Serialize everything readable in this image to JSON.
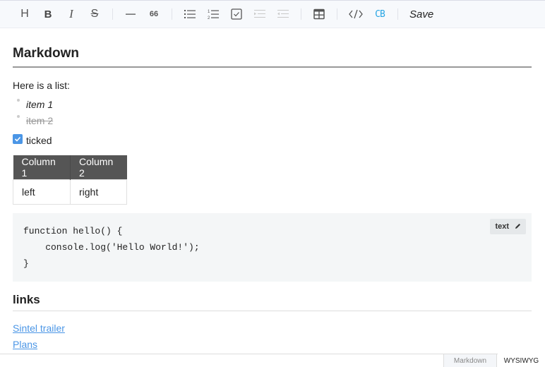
{
  "toolbar": {
    "buttons": [
      {
        "name": "heading",
        "icon": "heading-icon",
        "glyph": "H"
      },
      {
        "name": "bold",
        "icon": "bold-icon",
        "glyph": "B"
      },
      {
        "name": "italic",
        "icon": "italic-icon",
        "glyph": "I"
      },
      {
        "name": "strike",
        "icon": "strikethrough-icon",
        "glyph": "S"
      },
      {
        "name": "hr",
        "icon": "horizontal-rule-icon"
      },
      {
        "name": "quote",
        "icon": "quote-icon",
        "glyph": "66"
      },
      {
        "name": "ul",
        "icon": "bullet-list-icon"
      },
      {
        "name": "ol",
        "icon": "numbered-list-icon"
      },
      {
        "name": "task",
        "icon": "task-list-icon"
      },
      {
        "name": "indent",
        "icon": "indent-icon"
      },
      {
        "name": "outdent",
        "icon": "outdent-icon"
      },
      {
        "name": "table",
        "icon": "table-icon"
      },
      {
        "name": "code",
        "icon": "code-icon",
        "glyph": "</>"
      },
      {
        "name": "codeblock",
        "icon": "codeblock-icon",
        "glyph": "CB"
      }
    ],
    "save_label": "Save",
    "accent_color": "#28a6e4"
  },
  "document": {
    "heading1": "Markdown",
    "intro": "Here is a list:",
    "list": [
      {
        "text": "item 1",
        "style": "italic"
      },
      {
        "text": "item 2",
        "style": "strikethrough"
      }
    ],
    "task": {
      "label": "ticked",
      "checked": true
    },
    "table": {
      "headers": [
        "Column 1",
        "Column 2"
      ],
      "rows": [
        [
          "left",
          "right"
        ]
      ]
    },
    "code": {
      "language": "text",
      "lines": [
        "function hello() {",
        "    console.log('Hello World!');",
        "}"
      ]
    },
    "heading2": "links",
    "links": [
      {
        "text": "Sintel trailer"
      },
      {
        "text": "Plans"
      }
    ],
    "link_color": "#4b96e6"
  },
  "mode_switch": {
    "tabs": [
      "Markdown",
      "WYSIWYG"
    ],
    "active": "WYSIWYG"
  }
}
